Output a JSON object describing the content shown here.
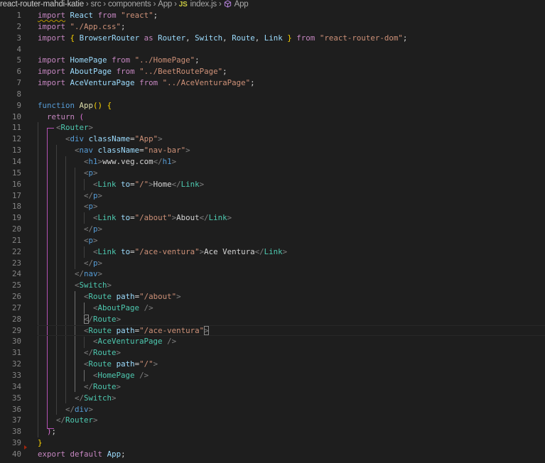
{
  "breadcrumb": {
    "items": [
      "react-router-mahdi-katie",
      "src",
      "components",
      "App",
      "index.js",
      "App"
    ],
    "file_icon": "JS",
    "symbol_icon": "cube-icon"
  },
  "editor": {
    "current_line": 29,
    "lines": [
      {
        "n": "1"
      },
      {
        "n": "2"
      },
      {
        "n": "3"
      },
      {
        "n": "4"
      },
      {
        "n": "5"
      },
      {
        "n": "6"
      },
      {
        "n": "7"
      },
      {
        "n": "8"
      },
      {
        "n": "9"
      },
      {
        "n": "10"
      },
      {
        "n": "11"
      },
      {
        "n": "12"
      },
      {
        "n": "13"
      },
      {
        "n": "14"
      },
      {
        "n": "15"
      },
      {
        "n": "16"
      },
      {
        "n": "17"
      },
      {
        "n": "18"
      },
      {
        "n": "19"
      },
      {
        "n": "20"
      },
      {
        "n": "21"
      },
      {
        "n": "22"
      },
      {
        "n": "23"
      },
      {
        "n": "24"
      },
      {
        "n": "25"
      },
      {
        "n": "26"
      },
      {
        "n": "27"
      },
      {
        "n": "28"
      },
      {
        "n": "29"
      },
      {
        "n": "30"
      },
      {
        "n": "31"
      },
      {
        "n": "32"
      },
      {
        "n": "33"
      },
      {
        "n": "34"
      },
      {
        "n": "35"
      },
      {
        "n": "36"
      },
      {
        "n": "37"
      },
      {
        "n": "38"
      },
      {
        "n": "39"
      },
      {
        "n": "40"
      }
    ],
    "tokens": {
      "import": "import",
      "from": "from",
      "as": "as",
      "function": "function",
      "return": "return",
      "export": "export",
      "default": "default",
      "React": "React",
      "str_react": "\"react\"",
      "str_appcss": "\"./App.css\"",
      "BrowserRouter": "BrowserRouter",
      "Router": "Router",
      "Switch": "Switch",
      "Route": "Route",
      "Link": "Link",
      "str_rrd": "\"react-router-dom\"",
      "HomePage": "HomePage",
      "str_home": "\"../HomePage\"",
      "AboutPage": "AboutPage",
      "str_about": "\"../BeetRoutePage\"",
      "AceVenturaPage": "AceVenturaPage",
      "str_ace": "\"../AceVenturaPage\"",
      "App": "App",
      "div": "div",
      "nav": "nav",
      "h1": "h1",
      "p": "p",
      "className": "className",
      "to": "to",
      "path": "path",
      "str_App": "\"App\"",
      "str_navbar": "\"nav-bar\"",
      "h1_text": "www.veg.com",
      "str_slash": "\"/\"",
      "str_about_path": "\"/about\"",
      "str_ace_path": "\"/ace-ventura\"",
      "link_home": "Home",
      "link_about": "About",
      "link_ace": "Ace Ventura"
    }
  }
}
